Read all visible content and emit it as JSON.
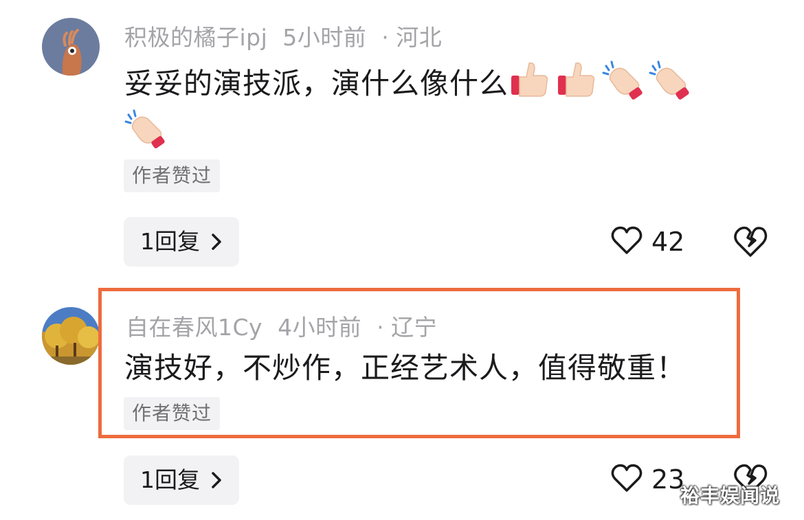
{
  "comments": [
    {
      "username": "积极的橘子ipj",
      "time": "5小时前",
      "dot": "·",
      "location": "河北",
      "text": "妥妥的演技派，演什么像什么",
      "emojis": [
        "thumbs-up",
        "thumbs-up",
        "clapping-hands",
        "clapping-hands",
        "clapping-hands"
      ],
      "badge": "作者赞过",
      "reply_label": "1回复",
      "likes": "42"
    },
    {
      "username": "自在春风1Cy",
      "time": "4小时前",
      "dot": "·",
      "location": "辽宁",
      "text": "演技好，不炒作，正经艺术人，值得敬重！",
      "badge": "作者赞过",
      "reply_label": "1回复",
      "likes": "23"
    }
  ],
  "watermark": "裕丰娱闻说",
  "colors": {
    "highlight_border": "#ee6b3d",
    "meta_text": "#a4a4a8",
    "tag_bg": "#f2f2f4"
  }
}
